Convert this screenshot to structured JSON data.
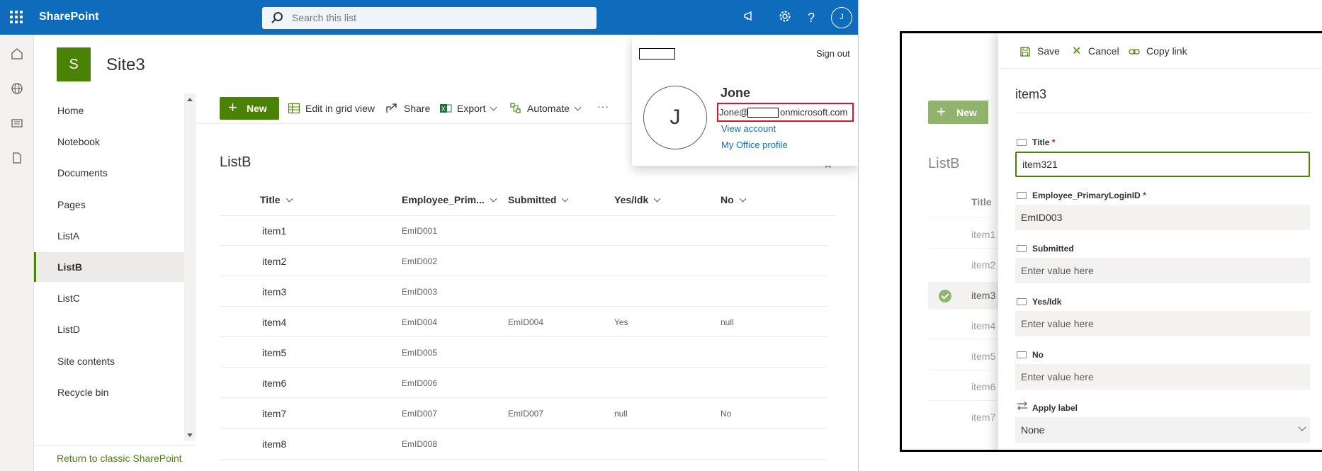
{
  "suite": {
    "brand": "SharePoint",
    "search_placeholder": "Search this list",
    "avatar_initial": "J"
  },
  "site": {
    "logo_letter": "S",
    "name": "Site3"
  },
  "nav": {
    "items": [
      "Home",
      "Notebook",
      "Documents",
      "Pages",
      "ListA",
      "ListB",
      "ListC",
      "ListD",
      "Site contents",
      "Recycle bin"
    ],
    "selected": "ListB",
    "classic_link": "Return to classic SharePoint"
  },
  "commands": {
    "new": "New",
    "edit_grid": "Edit in grid view",
    "share": "Share",
    "export": "Export",
    "automate": "Automate",
    "more": "···"
  },
  "list": {
    "title": "ListB",
    "columns": [
      "Title",
      "Employee_Prim...",
      "Submitted",
      "Yes/Idk",
      "No"
    ],
    "rows": [
      {
        "title": "item1",
        "emp": "EmID001",
        "submitted": "",
        "yes": "",
        "no": ""
      },
      {
        "title": "item2",
        "emp": "EmID002",
        "submitted": "",
        "yes": "",
        "no": ""
      },
      {
        "title": "item3",
        "emp": "EmID003",
        "submitted": "",
        "yes": "",
        "no": ""
      },
      {
        "title": "item4",
        "emp": "EmID004",
        "submitted": "EmID004",
        "yes": "Yes",
        "no": "null"
      },
      {
        "title": "item5",
        "emp": "EmID005",
        "submitted": "",
        "yes": "",
        "no": ""
      },
      {
        "title": "item6",
        "emp": "EmID006",
        "submitted": "",
        "yes": "",
        "no": ""
      },
      {
        "title": "item7",
        "emp": "EmID007",
        "submitted": "EmID007",
        "yes": "null",
        "no": "No"
      },
      {
        "title": "item8",
        "emp": "EmID008",
        "submitted": "",
        "yes": "",
        "no": ""
      }
    ]
  },
  "account": {
    "sign_out": "Sign out",
    "initial": "J",
    "name": "Jone",
    "email_prefix": "Jone@",
    "email_suffix": "onmicrosoft.com",
    "view_account": "View account",
    "office_profile": "My Office profile"
  },
  "background_list": {
    "new": "New",
    "title": "ListB",
    "column": "Title",
    "items": [
      "item1",
      "item2",
      "item3",
      "item4",
      "item5",
      "item6",
      "item7"
    ]
  },
  "panel": {
    "save": "Save",
    "cancel": "Cancel",
    "copy_link": "Copy link",
    "item_name": "item3",
    "fields": {
      "title_label": "Title",
      "title_value": "item321",
      "emp_label": "Employee_PrimaryLoginID",
      "emp_value": "EmID003",
      "submitted_label": "Submitted",
      "yes_label": "Yes/Idk",
      "no_label": "No",
      "placeholder": "Enter value here",
      "required_mark": "*",
      "apply_label": "Apply label",
      "apply_value": "None"
    }
  }
}
